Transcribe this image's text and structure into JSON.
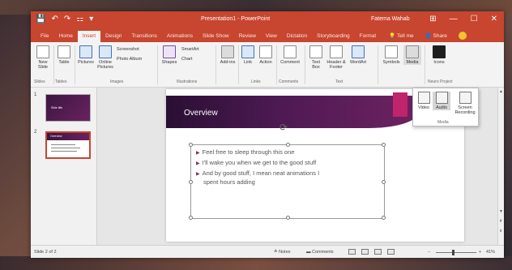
{
  "titlebar": {
    "qat": [
      "💾",
      "↶",
      "↷",
      "⚏",
      "▾"
    ],
    "title": "Presentation1 - PowerPoint",
    "user": "Fatema Wahab",
    "controls": [
      "⊞",
      "—",
      "☐",
      "✕"
    ]
  },
  "tabs": [
    "File",
    "Home",
    "Insert",
    "Design",
    "Transitions",
    "Animations",
    "Slide Show",
    "Review",
    "View",
    "Dictation",
    "Storyboarding",
    "Format"
  ],
  "active_tab": "Insert",
  "tell_me": "Tell me",
  "share": "Share",
  "ribbon": {
    "new_slide": "New Slide",
    "table": "Table",
    "pictures": "Pictures",
    "online_pictures": "Online Pictures",
    "screenshot": "Screenshot",
    "photo_album": "Photo Album",
    "shapes": "Shapes",
    "smartart": "SmartArt",
    "chart": "Chart",
    "addins": "Add-ins",
    "link": "Link",
    "action": "Action",
    "comment": "Comment",
    "text_box": "Text Box",
    "header_footer": "Header & Footer",
    "wordart": "WordArt",
    "symbols": "Symbols",
    "media": "Media",
    "icons": "Icons",
    "groups": {
      "slides": "Slides",
      "tables": "Tables",
      "images": "Images",
      "illustrations": "Illustrations",
      "links": "Links",
      "comments": "Comments",
      "text": "Text",
      "neuro": "Neuro Project"
    }
  },
  "media_menu": {
    "video": "Video",
    "audio": "Audio",
    "screen_recording": "Screen Recording",
    "group_label": "Media"
  },
  "thumbnails": [
    {
      "number": "1",
      "title": "Slide title"
    },
    {
      "number": "2",
      "title": "Overview"
    }
  ],
  "slide": {
    "title": "Overview",
    "bullets": [
      "Feel free to sleep through this one",
      "I'll wake you when we get to the good stuff",
      "And by good stuff, I mean neat animations I",
      "spent hours adding"
    ]
  },
  "statusbar": {
    "slide_count": "Slide 2 of 2",
    "notes": "Notes",
    "comments": "Comments",
    "zoom": "41%"
  },
  "colors": {
    "accent": "#c8452f",
    "slide_banner": "#4d1a52",
    "pink": "#c0246c"
  }
}
